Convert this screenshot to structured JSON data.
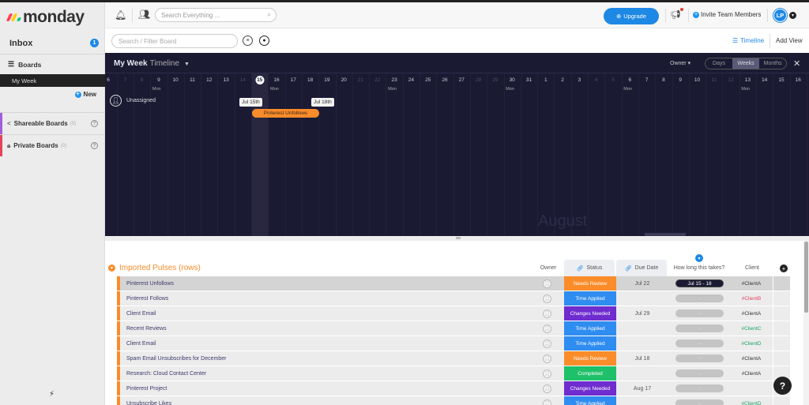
{
  "app": {
    "brand": "monday",
    "brand_colors": [
      "#ff3d57",
      "#ffcb00",
      "#00ca72"
    ]
  },
  "sidebar": {
    "inbox_label": "Inbox",
    "inbox_count": "1",
    "boards_label": "Boards",
    "active_board": "My Week",
    "new_label": "New",
    "sections": [
      {
        "label": "Shareable Boards",
        "count": "(0)",
        "color": "#a25ddc",
        "icon": "share-icon"
      },
      {
        "label": "Private Boards",
        "count": "(0)",
        "color": "#e2445c",
        "icon": "lock-icon"
      }
    ]
  },
  "header": {
    "search_placeholder": "Search Everything ...",
    "upgrade_label": "Upgrade",
    "invite_label": "Invite Team Members",
    "avatar_initials": "LP"
  },
  "filterbar": {
    "filter_placeholder": "Search / Filter Board",
    "view_label": "Timeline",
    "add_view_label": "Add View"
  },
  "timeline": {
    "title": "My Week",
    "subtitle": "Timeline",
    "group_by": "Owner",
    "scale_options": [
      "Days",
      "Weeks",
      "Months"
    ],
    "selected_scale": "Weeks",
    "days": [
      {
        "n": "6",
        "we": false
      },
      {
        "n": "7",
        "we": true
      },
      {
        "n": "8",
        "we": true
      },
      {
        "n": "9",
        "we": false,
        "mon": true
      },
      {
        "n": "10",
        "we": false
      },
      {
        "n": "11",
        "we": false
      },
      {
        "n": "12",
        "we": false
      },
      {
        "n": "13",
        "we": false
      },
      {
        "n": "14",
        "we": true
      },
      {
        "n": "15",
        "we": true,
        "today": true
      },
      {
        "n": "16",
        "we": false,
        "mon": true
      },
      {
        "n": "17",
        "we": false
      },
      {
        "n": "18",
        "we": false
      },
      {
        "n": "19",
        "we": false
      },
      {
        "n": "20",
        "we": false
      },
      {
        "n": "21",
        "we": true
      },
      {
        "n": "22",
        "we": true
      },
      {
        "n": "23",
        "we": false,
        "mon": true
      },
      {
        "n": "24",
        "we": false
      },
      {
        "n": "25",
        "we": false
      },
      {
        "n": "26",
        "we": false
      },
      {
        "n": "27",
        "we": false
      },
      {
        "n": "28",
        "we": true
      },
      {
        "n": "29",
        "we": true
      },
      {
        "n": "30",
        "we": false,
        "mon": true
      },
      {
        "n": "31",
        "we": false
      },
      {
        "n": "1",
        "we": false
      },
      {
        "n": "2",
        "we": false
      },
      {
        "n": "3",
        "we": false
      },
      {
        "n": "4",
        "we": true
      },
      {
        "n": "5",
        "we": true
      },
      {
        "n": "6",
        "we": false,
        "mon": true
      },
      {
        "n": "7",
        "we": false
      },
      {
        "n": "8",
        "we": false
      },
      {
        "n": "9",
        "we": false
      },
      {
        "n": "10",
        "we": false
      },
      {
        "n": "11",
        "we": true
      },
      {
        "n": "12",
        "we": true
      },
      {
        "n": "13",
        "we": false,
        "mon": true
      },
      {
        "n": "14",
        "we": false
      },
      {
        "n": "15",
        "we": false
      },
      {
        "n": "16",
        "we": false
      }
    ],
    "mon_label": "Mon",
    "row_label": "Unassigned",
    "start_tip": "Jul 15th",
    "end_tip": "Jul 18th",
    "bar_label": "Pinterest Unfollows",
    "month_watermark": "August"
  },
  "table": {
    "group_title": "Imported Pulses (rows)",
    "group_color": "#fb8c2a",
    "columns": {
      "owner": "Owner",
      "status": "Status",
      "due": "Due Date",
      "duration": "How long this takes?",
      "client": "Client"
    },
    "status_colors": {
      "Needs Review": "#fb8c2a",
      "Time Applied": "#2f8cf0",
      "Changes Needed": "#6f2ccf",
      "Completed": "#1fc06a"
    },
    "client_colors": {
      "#ClientA": "#333333",
      "#ClientB": "#e2445c",
      "#ClientC": "#1fa463",
      "#ClientD": "#1fa463"
    },
    "rows": [
      {
        "name": "Pinterest Unfollows",
        "status": "Needs Review",
        "due": "Jul 22",
        "duration": "Jul 15 - 18",
        "client": "#ClientA",
        "selected": true
      },
      {
        "name": "Pinterest Follows",
        "status": "Time Applied",
        "due": "",
        "duration": "-",
        "client": "#ClientB"
      },
      {
        "name": "Client Email",
        "status": "Changes Needed",
        "due": "Jul 29",
        "duration": "-",
        "client": "#ClientA"
      },
      {
        "name": "Recent Reviews",
        "status": "Time Applied",
        "due": "",
        "duration": "-",
        "client": "#ClientC"
      },
      {
        "name": "Client Email",
        "status": "Time Applied",
        "due": "",
        "duration": "-",
        "client": "#ClientD"
      },
      {
        "name": "Spam Email Unsubscribes for December",
        "status": "Needs Review",
        "due": "Jul 18",
        "duration": "-",
        "client": "#ClientA"
      },
      {
        "name": "Research: Cloud Contact Center",
        "status": "Completed",
        "due": "",
        "duration": "-",
        "client": "#ClientA"
      },
      {
        "name": "Pinterest Project",
        "status": "Changes Needed",
        "due": "Aug 17",
        "duration": "-",
        "client": ""
      },
      {
        "name": "Unsubscribe Likes",
        "status": "Time Applied",
        "due": "",
        "duration": "-",
        "client": "#ClientD"
      }
    ]
  },
  "help_label": "?"
}
